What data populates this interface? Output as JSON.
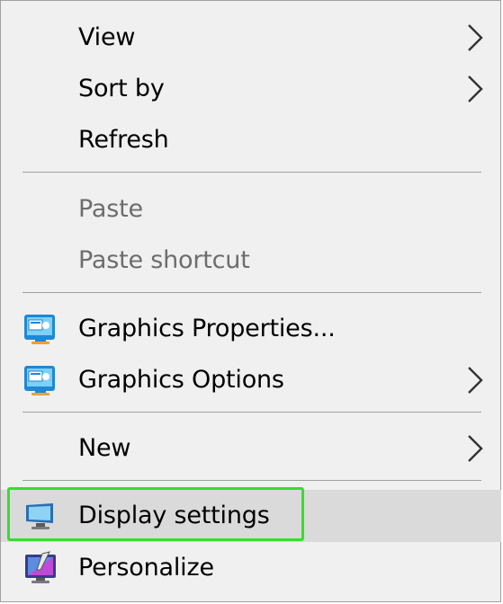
{
  "menu": {
    "items": [
      {
        "label": "View"
      },
      {
        "label": "Sort by"
      },
      {
        "label": "Refresh"
      },
      {
        "label": "Paste"
      },
      {
        "label": "Paste shortcut"
      },
      {
        "label": "Graphics Properties..."
      },
      {
        "label": "Graphics Options"
      },
      {
        "label": "New"
      },
      {
        "label": "Display settings"
      },
      {
        "label": "Personalize"
      }
    ]
  },
  "colors": {
    "menu_background": "#f0f0f0",
    "hover_background": "#dadada",
    "disabled_text": "#6d6d6d",
    "highlight_outline": "#33e02a",
    "separator": "#a0a0a0"
  },
  "icons": {
    "submenu": "chevron-right-icon",
    "graphics": "intel-graphics-icon",
    "display": "monitor-icon",
    "personalize": "personalize-monitor-icon"
  }
}
